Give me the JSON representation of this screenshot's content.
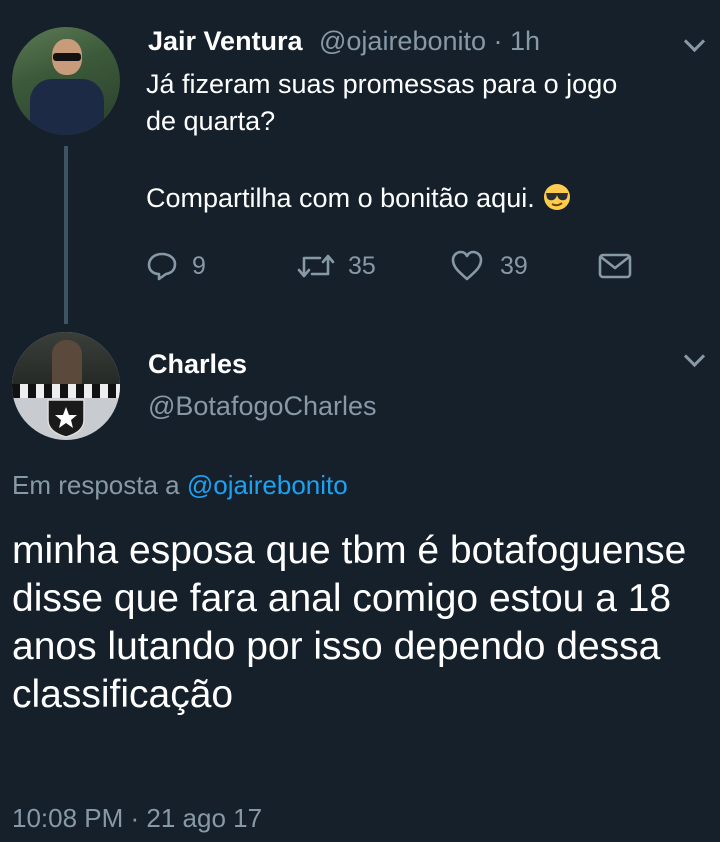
{
  "tweet1": {
    "name": "Jair Ventura",
    "handle_time": "@ojairebonito · 1h",
    "text_lines": [
      "Já fizeram suas promessas para o jogo",
      "de quarta?"
    ],
    "text_line2": "Compartilha com o bonitão aqui.",
    "emoji": "sunglasses-emoji",
    "actions": {
      "replies": "9",
      "retweets": "35",
      "likes": "39"
    }
  },
  "tweet2": {
    "name": "Charles",
    "handle": "@BotafogoCharles",
    "reply_prefix": "Em resposta a",
    "reply_mention": "@ojairebonito",
    "text": "minha esposa que tbm é botafoguense disse que fara anal comigo estou a 18 anos lutando por isso dependo dessa classificação",
    "timestamp": "10:08 PM · 21 ago 17"
  },
  "colors": {
    "background": "#15202b",
    "text": "#ffffff",
    "secondary": "#8899a6",
    "link": "#1da1f2"
  }
}
